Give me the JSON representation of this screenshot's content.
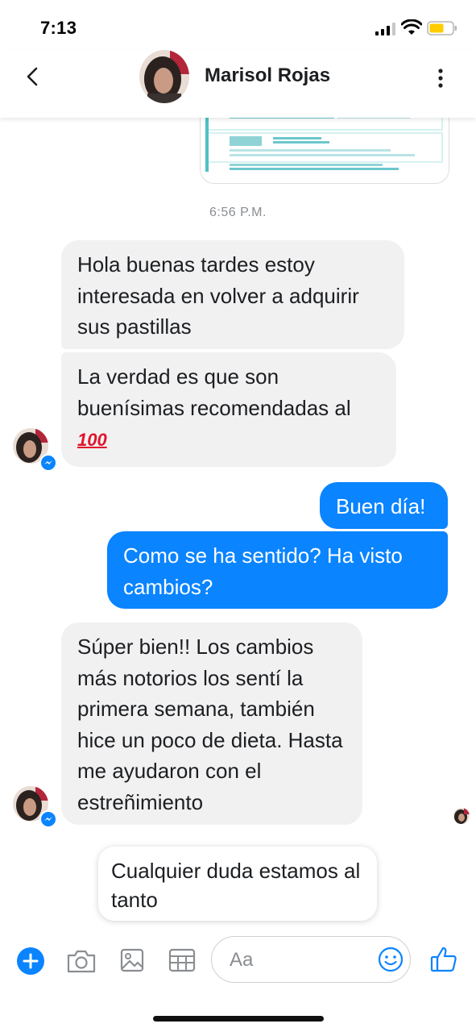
{
  "status_bar": {
    "time": "7:13"
  },
  "header": {
    "contact_name": "Marisol Rojas"
  },
  "chat": {
    "timestamp": "6:56 P.M.",
    "messages": [
      {
        "from": "contact",
        "text": "Hola buenas tardes estoy interesada en volver a adquirir sus pastillas"
      },
      {
        "from": "contact",
        "text": "La verdad es que son buenísimas recomendadas al",
        "emoji": "100"
      },
      {
        "from": "me",
        "text": "Buen día!"
      },
      {
        "from": "me",
        "text": "Como se ha sentido? Ha visto cambios?"
      },
      {
        "from": "contact",
        "text": "Súper bien!! Los cambios más notorios los sentí la primera semana, también hice un poco de dieta. Hasta me ayudaron con el estreñimiento"
      }
    ],
    "draft_card": "Cualquier duda estamos al tanto"
  },
  "composer": {
    "placeholder": "Aa",
    "icons": [
      "plus-icon",
      "camera-icon",
      "photo-icon",
      "grid-icon",
      "emoji-icon",
      "thumbs-up-icon"
    ]
  },
  "colors": {
    "accent": "#0a84ff",
    "incoming_bubble": "#f1f1f2",
    "timestamp": "#8a8d91"
  }
}
